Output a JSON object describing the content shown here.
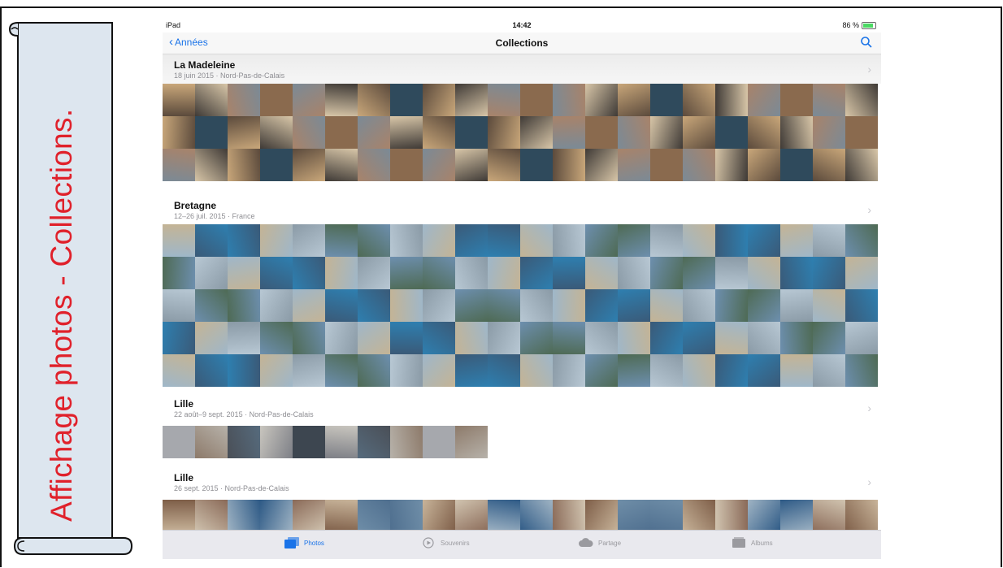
{
  "slide": {
    "banner_title": "Affichage photos -  Collections."
  },
  "statusbar": {
    "device": "iPad",
    "time": "14:42",
    "battery": "86 %"
  },
  "navbar": {
    "back_label": "Années",
    "title": "Collections"
  },
  "collections": [
    {
      "title": "La Madeleine",
      "subtitle": "18 juin 2015 · Nord-Pas-de-Calais",
      "rows": 3,
      "count": 66
    },
    {
      "title": "Bretagne",
      "subtitle": "12–26 juil. 2015 · France",
      "rows": 5,
      "count": 110
    },
    {
      "title": "Lille",
      "subtitle": "22 août–9 sept. 2015 · Nord-Pas-de-Calais",
      "rows": 1,
      "count": 10
    },
    {
      "title": "Lille",
      "subtitle": "26 sept. 2015 · Nord-Pas-de-Calais",
      "rows": 1,
      "count": 22
    }
  ],
  "tabbar": {
    "tabs": [
      {
        "label": "Photos",
        "icon": "photos-icon",
        "active": true
      },
      {
        "label": "Souvenirs",
        "icon": "memories-icon",
        "active": false
      },
      {
        "label": "Partage",
        "icon": "cloud-icon",
        "active": false
      },
      {
        "label": "Albums",
        "icon": "albums-icon",
        "active": false
      }
    ]
  },
  "colors": {
    "accent": "#1a73e8",
    "banner_text": "#e0212b",
    "banner_fill": "#dde6ef"
  }
}
